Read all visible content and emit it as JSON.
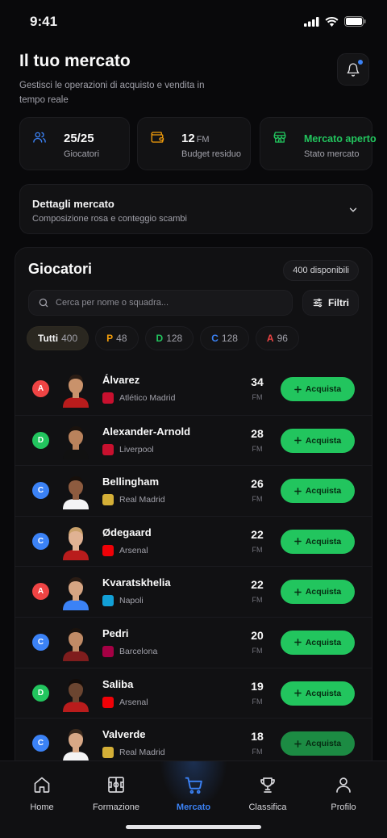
{
  "status_bar": {
    "time": "9:41"
  },
  "header": {
    "title": "Il tuo mercato",
    "subtitle": "Gestisci le operazioni di acquisto e vendita in tempo reale"
  },
  "stats": [
    {
      "value": "25/25",
      "unit": "",
      "label": "Giocatori",
      "icon": "users-icon",
      "color": "#3b82f6"
    },
    {
      "value": "12",
      "unit": "FM",
      "label": "Budget residuo",
      "icon": "wallet-icon",
      "color": "#f59e0b"
    },
    {
      "value": "Mercato aperto",
      "unit": "",
      "label": "Stato mercato",
      "icon": "store-icon",
      "color": "#22c55e"
    }
  ],
  "details": {
    "title": "Dettagli mercato",
    "subtitle": "Composizione rosa e conteggio scambi"
  },
  "players_panel": {
    "title": "Giocatori",
    "available": "400 disponibili",
    "search_placeholder": "Cerca per nome o squadra...",
    "filter_label": "Filtri",
    "chips": [
      {
        "key": "Tutti",
        "count": "400",
        "active": true,
        "color": "#f4f4f5"
      },
      {
        "key": "P",
        "count": "48",
        "active": false,
        "color": "#f59e0b"
      },
      {
        "key": "D",
        "count": "128",
        "active": false,
        "color": "#22c55e"
      },
      {
        "key": "C",
        "count": "128",
        "active": false,
        "color": "#3b82f6"
      },
      {
        "key": "A",
        "count": "96",
        "active": false,
        "color": "#ef4444"
      }
    ],
    "buy_label": "Acquista",
    "currency": "FM",
    "players": [
      {
        "role": "A",
        "role_color": "#ef4444",
        "name": "Álvarez",
        "club": "Atlético Madrid",
        "crest_color": "#c8102e",
        "price": "34",
        "shirt": "#b91c1c",
        "skin": "#c9926b",
        "hair": "#2a1c14"
      },
      {
        "role": "D",
        "role_color": "#22c55e",
        "name": "Alexander-Arnold",
        "club": "Liverpool",
        "crest_color": "#c8102e",
        "price": "28",
        "shirt": "#111111",
        "skin": "#b9825c",
        "hair": "#1a120d"
      },
      {
        "role": "C",
        "role_color": "#3b82f6",
        "name": "Bellingham",
        "club": "Real Madrid",
        "crest_color": "#d4af37",
        "price": "26",
        "shirt": "#f4f4f5",
        "skin": "#8d5b3f",
        "hair": "#160f0b"
      },
      {
        "role": "C",
        "role_color": "#3b82f6",
        "name": "Ødegaard",
        "club": "Arsenal",
        "crest_color": "#ef0107",
        "price": "22",
        "shirt": "#b91c1c",
        "skin": "#e0b293",
        "hair": "#c9a06a"
      },
      {
        "role": "A",
        "role_color": "#ef4444",
        "name": "Kvaratskhelia",
        "club": "Napoli",
        "crest_color": "#12a0d7",
        "price": "22",
        "shirt": "#3b82f6",
        "skin": "#d6a583",
        "hair": "#2a1c14"
      },
      {
        "role": "C",
        "role_color": "#3b82f6",
        "name": "Pedri",
        "club": "Barcelona",
        "crest_color": "#a50044",
        "price": "20",
        "shirt": "#7f1d1d",
        "skin": "#c08b66",
        "hair": "#1a120d"
      },
      {
        "role": "D",
        "role_color": "#22c55e",
        "name": "Saliba",
        "club": "Arsenal",
        "crest_color": "#ef0107",
        "price": "19",
        "shirt": "#b91c1c",
        "skin": "#6b4530",
        "hair": "#120c09"
      },
      {
        "role": "C",
        "role_color": "#3b82f6",
        "name": "Valverde",
        "club": "Real Madrid",
        "crest_color": "#d4af37",
        "price": "18",
        "shirt": "#f4f4f5",
        "skin": "#d8a886",
        "hair": "#3b2a1d"
      }
    ]
  },
  "nav": [
    {
      "label": "Home",
      "icon": "home-icon",
      "active": false
    },
    {
      "label": "Formazione",
      "icon": "pitch-icon",
      "active": false
    },
    {
      "label": "Mercato",
      "icon": "cart-icon",
      "active": true
    },
    {
      "label": "Classifica",
      "icon": "trophy-icon",
      "active": false
    },
    {
      "label": "Profilo",
      "icon": "user-icon",
      "active": false
    }
  ],
  "colors": {
    "accent": "#3b82f6",
    "buy": "#22c55e",
    "background": "#09090b"
  }
}
